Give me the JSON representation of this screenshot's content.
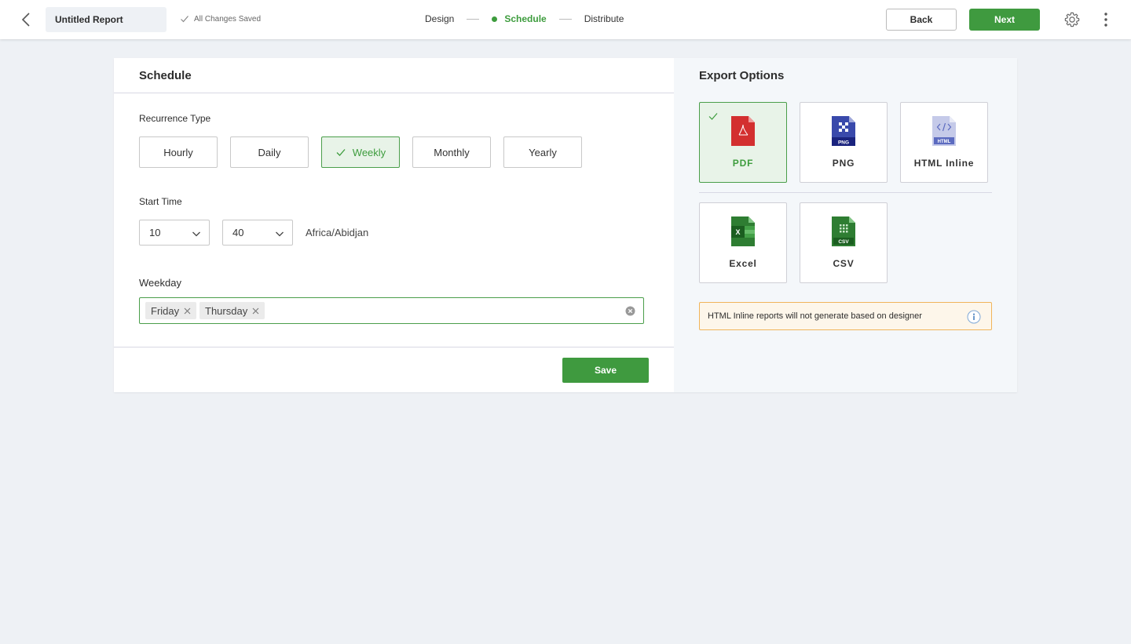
{
  "header": {
    "report_name": "Untitled Report",
    "save_status": "All Changes Saved",
    "steps": [
      "Design",
      "Schedule",
      "Distribute"
    ],
    "active_step": "Schedule",
    "back_label": "Back",
    "next_label": "Next",
    "accent_color": "#3f9a3f"
  },
  "schedule": {
    "title": "Schedule",
    "recurrence_label": "Recurrence Type",
    "recurrence_options": [
      "Hourly",
      "Daily",
      "Weekly",
      "Monthly",
      "Yearly"
    ],
    "recurrence_selected": "Weekly",
    "start_time_label": "Start Time",
    "hour": "10",
    "minute": "40",
    "timezone": "Africa/Abidjan",
    "weekday_label": "Weekday",
    "weekdays_selected": [
      "Friday",
      "Thursday"
    ],
    "save_label": "Save"
  },
  "export": {
    "title": "Export Options",
    "formats": [
      {
        "label": "PDF",
        "icon": "pdf-file-icon",
        "selected": true
      },
      {
        "label": "PNG",
        "icon": "png-file-icon",
        "selected": false
      },
      {
        "label": "HTML Inline",
        "icon": "html-file-icon",
        "selected": false
      },
      {
        "label": "Excel",
        "icon": "excel-file-icon",
        "selected": false
      },
      {
        "label": "CSV",
        "icon": "csv-file-icon",
        "selected": false
      }
    ],
    "notice": "HTML Inline reports will not generate based on designer",
    "icon_text": {
      "png": "PNG",
      "html": "HTML",
      "excel": "X",
      "csv": "CSV"
    }
  }
}
